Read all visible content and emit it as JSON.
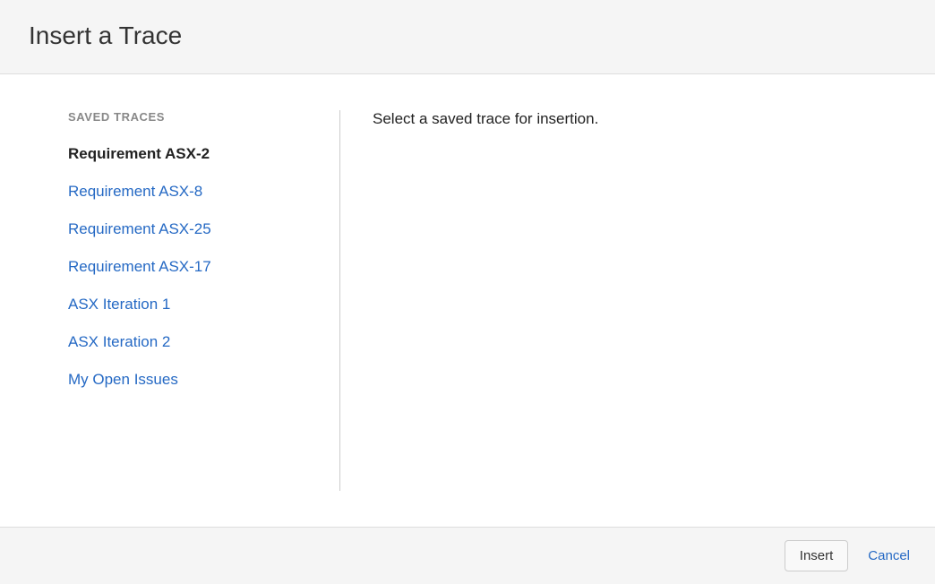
{
  "dialog": {
    "title": "Insert a Trace"
  },
  "sidebar": {
    "heading": "SAVED TRACES",
    "items": [
      {
        "label": "Requirement ASX-2",
        "selected": true
      },
      {
        "label": "Requirement ASX-8",
        "selected": false
      },
      {
        "label": "Requirement ASX-25",
        "selected": false
      },
      {
        "label": "Requirement ASX-17",
        "selected": false
      },
      {
        "label": "ASX Iteration 1",
        "selected": false
      },
      {
        "label": "ASX Iteration 2",
        "selected": false
      },
      {
        "label": "My Open Issues",
        "selected": false
      }
    ]
  },
  "main": {
    "prompt": "Select a saved trace for insertion."
  },
  "footer": {
    "insert_label": "Insert",
    "cancel_label": "Cancel"
  }
}
